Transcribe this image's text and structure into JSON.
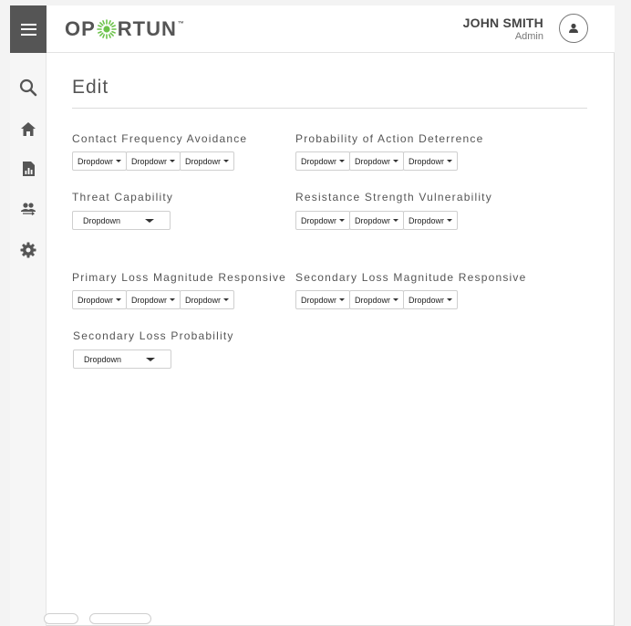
{
  "app": {
    "logo_left": "OP",
    "logo_right": "RTUN",
    "logo_mark": "™",
    "brand_color": "#6cc24a"
  },
  "header": {
    "user_name": "JOHN SMITH",
    "user_role": "Admin"
  },
  "sidebar": {
    "items": [
      {
        "icon": "search-icon"
      },
      {
        "icon": "home-icon"
      },
      {
        "icon": "report-icon"
      },
      {
        "icon": "users-icon"
      },
      {
        "icon": "gear-icon"
      }
    ]
  },
  "page": {
    "title": "Edit"
  },
  "fields": {
    "contact_frequency": {
      "label": "Contact Frequency Avoidance",
      "options": [
        "Dropdowr",
        "Dropdowr",
        "Dropdowr"
      ]
    },
    "probability_action": {
      "label": "Probability of Action Deterrence",
      "options": [
        "Dropdowr",
        "Dropdowr",
        "Dropdowr"
      ]
    },
    "threat_capability": {
      "label": "Threat Capability",
      "value": "Dropdown"
    },
    "resistance_strength": {
      "label": "Resistance Strength Vulnerability",
      "options": [
        "Dropdowr",
        "Dropdowr",
        "Dropdowr"
      ]
    },
    "primary_loss": {
      "label": "Primary Loss Magnitude Responsive",
      "options": [
        "Dropdowr",
        "Dropdowr",
        "Dropdowr"
      ]
    },
    "secondary_loss_magnitude": {
      "label": "Secondary Loss Magnitude Responsive",
      "options": [
        "Dropdowr",
        "Dropdowr",
        "Dropdowr"
      ]
    },
    "secondary_loss_probability": {
      "label": "Secondary Loss Probability",
      "value": "Dropdown"
    }
  }
}
